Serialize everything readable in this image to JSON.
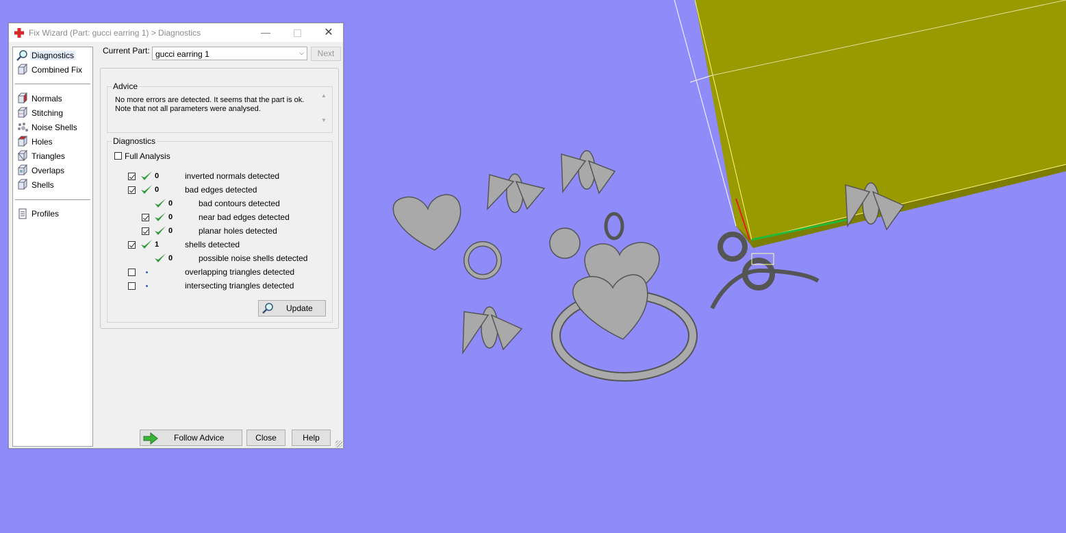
{
  "window": {
    "title": "Fix Wizard (Part: gucci earring 1) > Diagnostics"
  },
  "sidebar": {
    "items": [
      {
        "label": "Diagnostics",
        "icon": "magnifier-icon",
        "selected": true
      },
      {
        "label": "Combined Fix",
        "icon": "cube-icon"
      },
      {
        "label": "Normals",
        "icon": "cube-red-icon"
      },
      {
        "label": "Stitching",
        "icon": "cube-stitch-icon"
      },
      {
        "label": "Noise Shells",
        "icon": "dots-cube-icon"
      },
      {
        "label": "Holes",
        "icon": "cube-hole-icon"
      },
      {
        "label": "Triangles",
        "icon": "cube-triangle-icon"
      },
      {
        "label": "Overlaps",
        "icon": "cube-overlap-icon"
      },
      {
        "label": "Shells",
        "icon": "cube-shell-icon"
      },
      {
        "label": "Profiles",
        "icon": "document-icon"
      }
    ]
  },
  "current_part": {
    "label": "Current Part:",
    "value": "gucci earring 1",
    "next_label": "Next"
  },
  "advice": {
    "title": "Advice",
    "line1": "No more errors are detected. It seems that the part is ok.",
    "line2": "Note that not all parameters were analysed."
  },
  "diagnostics": {
    "title": "Diagnostics",
    "full_analysis_label": "Full Analysis",
    "rows": [
      {
        "checked": true,
        "status": "ok",
        "count": "0",
        "label": "inverted normals detected",
        "indent": 0
      },
      {
        "checked": true,
        "status": "ok",
        "count": "0",
        "label": "bad edges detected",
        "indent": 0
      },
      {
        "checked": null,
        "status": "ok",
        "count": "0",
        "label": "bad contours detected",
        "indent": 1
      },
      {
        "checked": true,
        "status": "ok",
        "count": "0",
        "label": "near bad edges detected",
        "indent": 1
      },
      {
        "checked": true,
        "status": "ok",
        "count": "0",
        "label": "planar holes detected",
        "indent": 1
      },
      {
        "checked": true,
        "status": "ok",
        "count": "1",
        "label": "shells detected",
        "indent": 0
      },
      {
        "checked": null,
        "status": "ok",
        "count": "0",
        "label": "possible noise shells detected",
        "indent": 1
      },
      {
        "checked": false,
        "status": "none",
        "count": "",
        "label": "overlapping triangles detected",
        "indent": 0
      },
      {
        "checked": false,
        "status": "none",
        "count": "",
        "label": "intersecting triangles detected",
        "indent": 0
      }
    ],
    "update_label": "Update"
  },
  "footer": {
    "follow_advice_label": "Follow Advice",
    "close_label": "Close",
    "help_label": "Help"
  },
  "colors": {
    "viewport_bg": "#8f8cfa",
    "build_plate": "#9a9a00",
    "model_gray": "#a9a9a9",
    "ok_green": "#2e9a3a"
  }
}
